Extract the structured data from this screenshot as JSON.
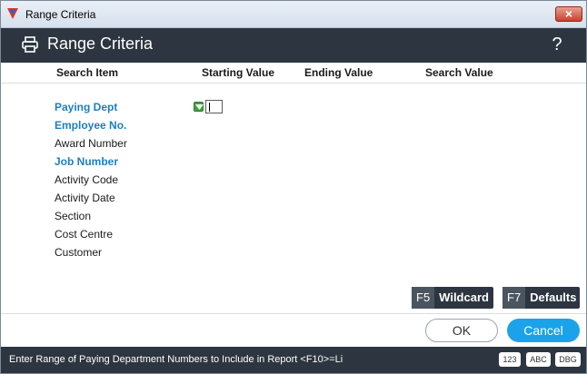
{
  "window": {
    "title": "Range Criteria",
    "close_glyph": "×"
  },
  "header": {
    "title": "Range Criteria",
    "help_glyph": "?"
  },
  "columns": [
    "Search Item",
    "Starting Value",
    "Ending Value",
    "Search Value"
  ],
  "rows": [
    {
      "label": "Paying Dept",
      "active": true
    },
    {
      "label": "Employee No.",
      "active": true
    },
    {
      "label": "Award Number",
      "active": false
    },
    {
      "label": "Job Number",
      "active": true
    },
    {
      "label": "Activity Code",
      "active": false
    },
    {
      "label": "Activity Date",
      "active": false
    },
    {
      "label": "Section",
      "active": false
    },
    {
      "label": "Cost Centre",
      "active": false
    },
    {
      "label": "Customer",
      "active": false
    }
  ],
  "start_input": {
    "value": ""
  },
  "fkeys": [
    {
      "key": "F5",
      "label": "Wildcard"
    },
    {
      "key": "F7",
      "label": "Defaults"
    }
  ],
  "buttons": {
    "ok": "OK",
    "cancel": "Cancel"
  },
  "status": {
    "text": "Enter Range of Paying Department Numbers to Include in Report <F10>=Li",
    "modes": [
      "123",
      "ABC",
      "DBG"
    ]
  },
  "colors": {
    "accent": "#1aa3e8",
    "header_bg": "#2d3640",
    "active_label": "#1c7fc0",
    "marker": "#3fa33f"
  },
  "icons": {
    "app": "app-logo-icon",
    "printer": "printer-icon",
    "help": "help-icon",
    "marker": "dropdown-marker-icon"
  }
}
